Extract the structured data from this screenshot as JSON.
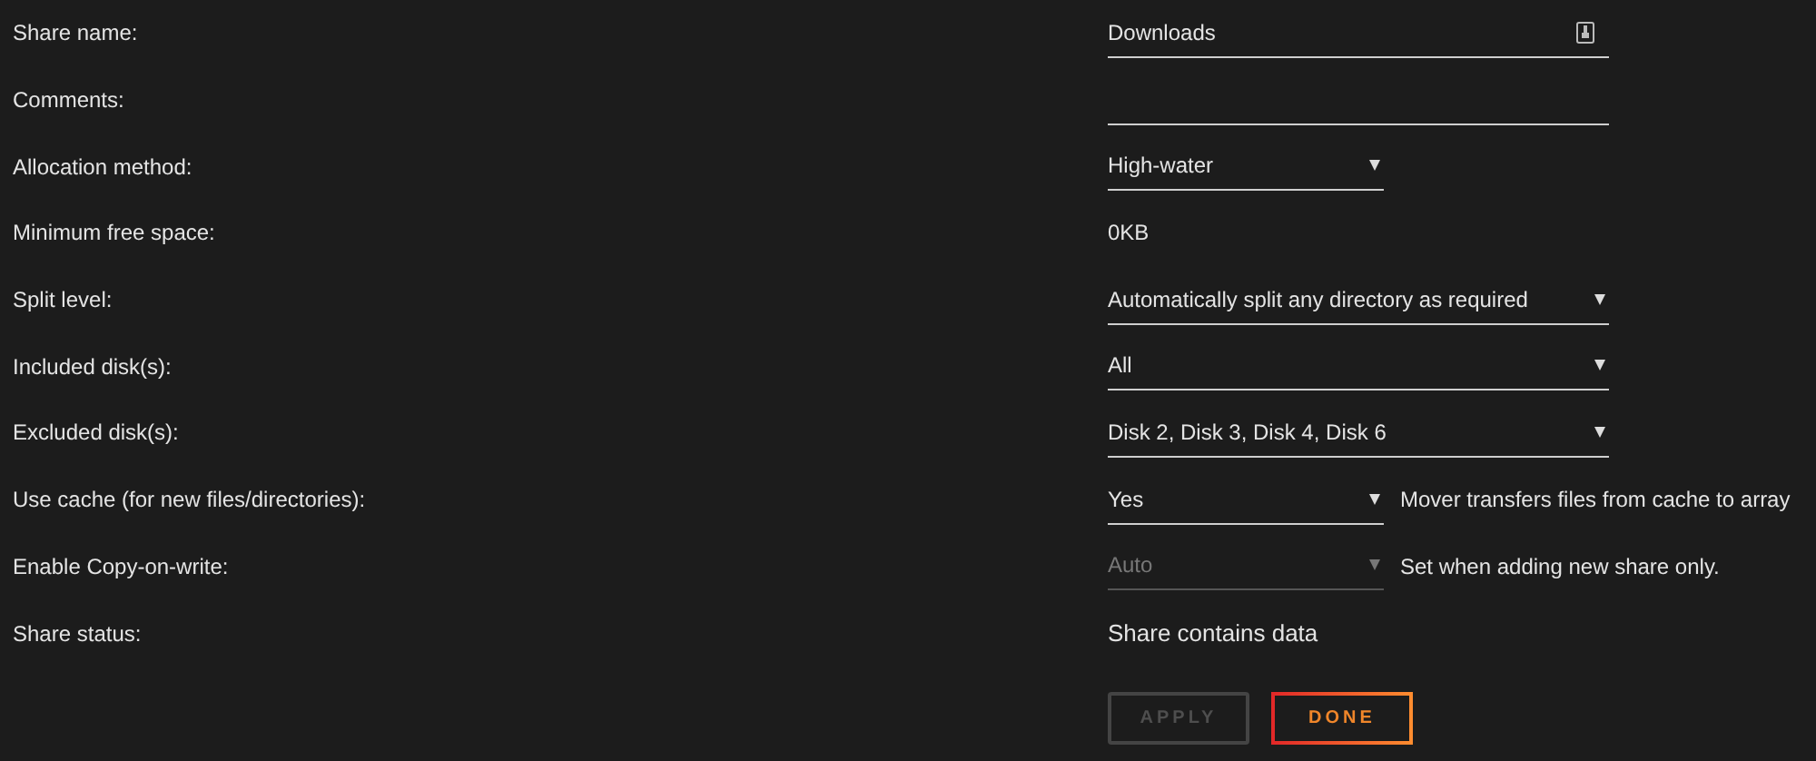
{
  "fields": [
    {
      "label": "Share name:",
      "kind": "text",
      "value": "Downloads",
      "icon": true
    },
    {
      "label": "Comments:",
      "kind": "text"
    },
    {
      "label": "Allocation method:",
      "kind": "compact-select",
      "value": "High-water",
      "disabled": false
    },
    {
      "label": "Minimum free space:",
      "kind": "plain",
      "value": "0KB"
    },
    {
      "label": "Split level:",
      "kind": "select",
      "value": "Automatically split any directory as required",
      "disabled": false
    },
    {
      "label": "Included disk(s):",
      "kind": "select",
      "value": "All",
      "disabled": false
    },
    {
      "label": "Excluded disk(s):",
      "kind": "select",
      "value": "Disk 2, Disk 3, Disk 4, Disk 6",
      "disabled": false
    },
    {
      "label": "Use cache (for new files/directories):",
      "kind": "compact-select",
      "value": "Yes",
      "disabled": false,
      "note": "Mover transfers files from cache to array"
    },
    {
      "label": "Enable Copy-on-write:",
      "kind": "compact-select",
      "value": "Auto",
      "disabled": true,
      "note": "Set when adding new share only."
    },
    {
      "label": "Share status:",
      "kind": "status",
      "value": "Share contains data"
    }
  ],
  "buttons": [
    {
      "label": "APPLY",
      "disabled": true
    },
    {
      "label": "DONE",
      "disabled": false
    }
  ]
}
